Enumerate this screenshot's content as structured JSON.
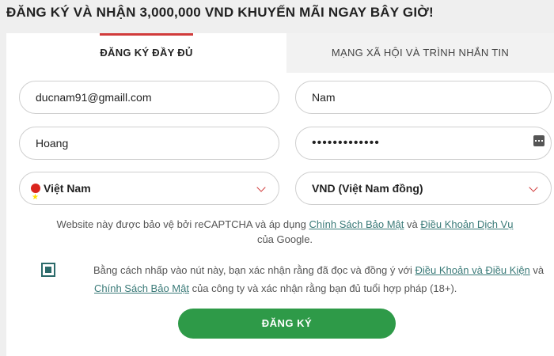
{
  "headline": "ĐĂNG KÝ VÀ NHẬN 3,000,000 VND KHUYẾN MÃI NGAY BÂY GIỜ!",
  "tabs": [
    {
      "label": "ĐĂNG KÝ ĐẦY ĐỦ",
      "active": true
    },
    {
      "label": "MẠNG XÃ HỘI VÀ TRÌNH NHẮN TIN",
      "active": false
    }
  ],
  "form": {
    "email": "ducnam91@gmaill.com",
    "first_name": "Nam",
    "last_name": "Hoang",
    "password_masked": "•••••••••••••",
    "country": "Việt Nam",
    "currency": "VND (Việt Nam đồng)"
  },
  "recaptcha": {
    "text_before": "Website này được bảo vệ bởi reCAPTCHA và áp dụng ",
    "privacy_link": "Chính Sách Bảo Mật",
    "text_middle": " và ",
    "terms_link": "Điều Khoản Dịch Vụ",
    "text_after": " của Google."
  },
  "consent": {
    "checked": true,
    "text_before": "Bằng cách nhấp vào nút này, bạn xác nhận rằng đã đọc và đồng ý với ",
    "terms_link": "Điều Khoản và Điều Kiện",
    "text_middle": " và",
    "privacy_link": "Chính Sách Bảo Mật",
    "text_after": " của công ty và xác nhận rằng bạn đủ tuổi hợp pháp (18+)."
  },
  "submit_label": "ĐĂNG KÝ",
  "colors": {
    "accent_red": "#d13b3b",
    "button_green": "#2e9a48",
    "link_teal": "#3a7a78"
  }
}
